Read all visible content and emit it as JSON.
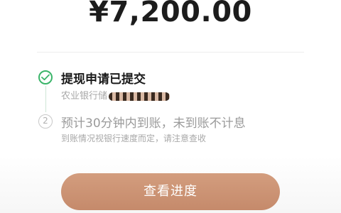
{
  "amount": "¥7,200.00",
  "steps": [
    {
      "number": "",
      "title": "提现申请已提交",
      "subtitle": "农业银行储",
      "status": "done",
      "icon": "check-icon",
      "color": "#3bb56a"
    },
    {
      "number": "2",
      "title": "预计30分钟内到账，未到账不计息",
      "subtitle": "到账情况视银行速度而定，请注意查收",
      "status": "pending"
    }
  ],
  "button": {
    "label": "查看进度",
    "color": "#c98f70"
  }
}
